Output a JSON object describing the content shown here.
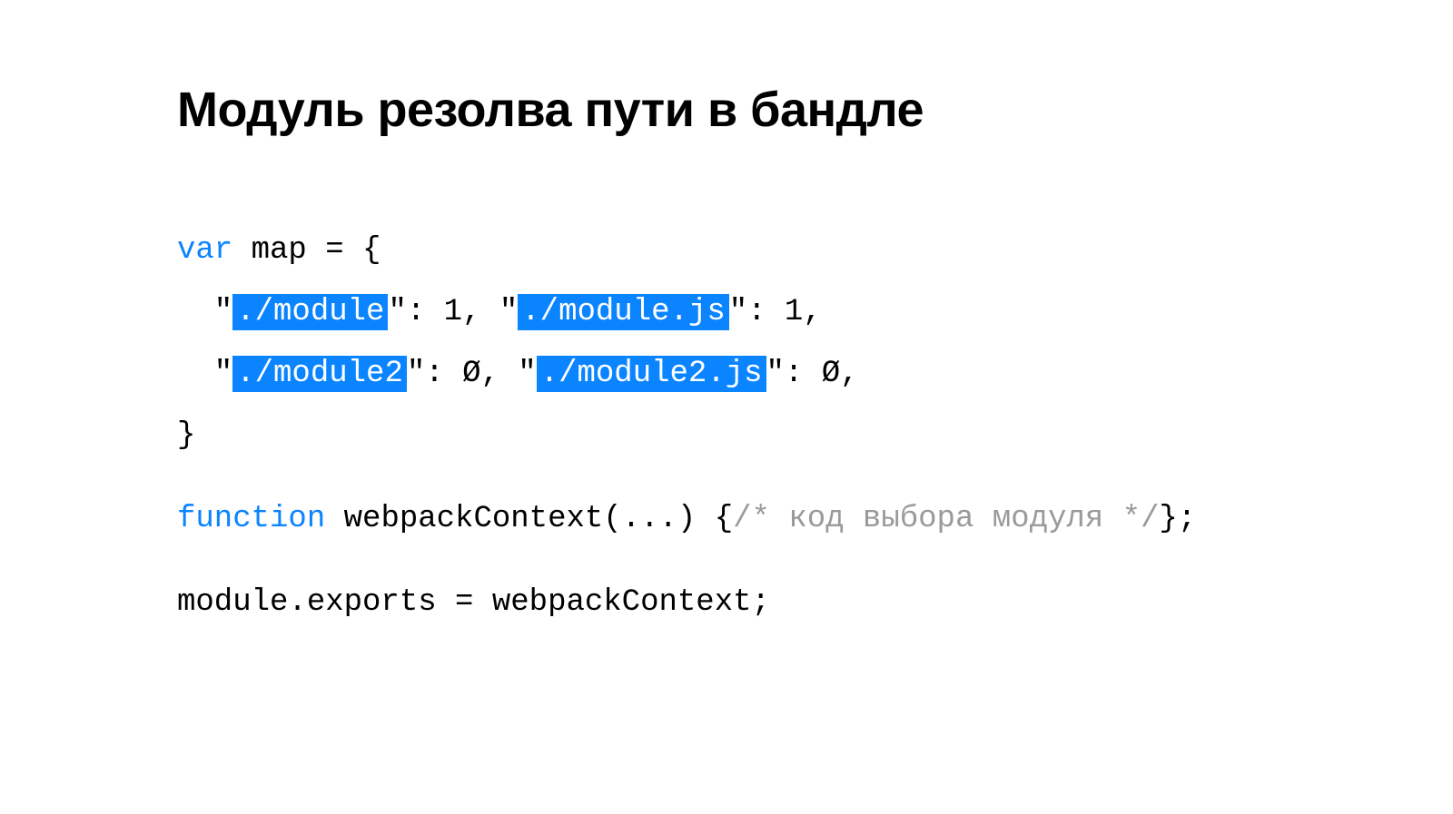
{
  "title": "Модуль резолва пути в бандле",
  "code": {
    "l1_kw": "var",
    "l1_rest": " map = {",
    "l2_a": "  \"",
    "l2_hl1": "./module",
    "l2_b": "\": 1, \"",
    "l2_hl2": "./module.js",
    "l2_c": "\": 1,",
    "l3_a": "  \"",
    "l3_hl1": "./module2",
    "l3_b": "\": Ø, \"",
    "l3_hl2": "./module2.js",
    "l3_c": "\": Ø,",
    "l4": "}",
    "l5_kw": "function",
    "l5_mid": " webpackContext(...) {",
    "l5_cmt": "/* код выбора модуля */",
    "l5_end": "};",
    "l6": "module.exports = webpackContext;"
  }
}
